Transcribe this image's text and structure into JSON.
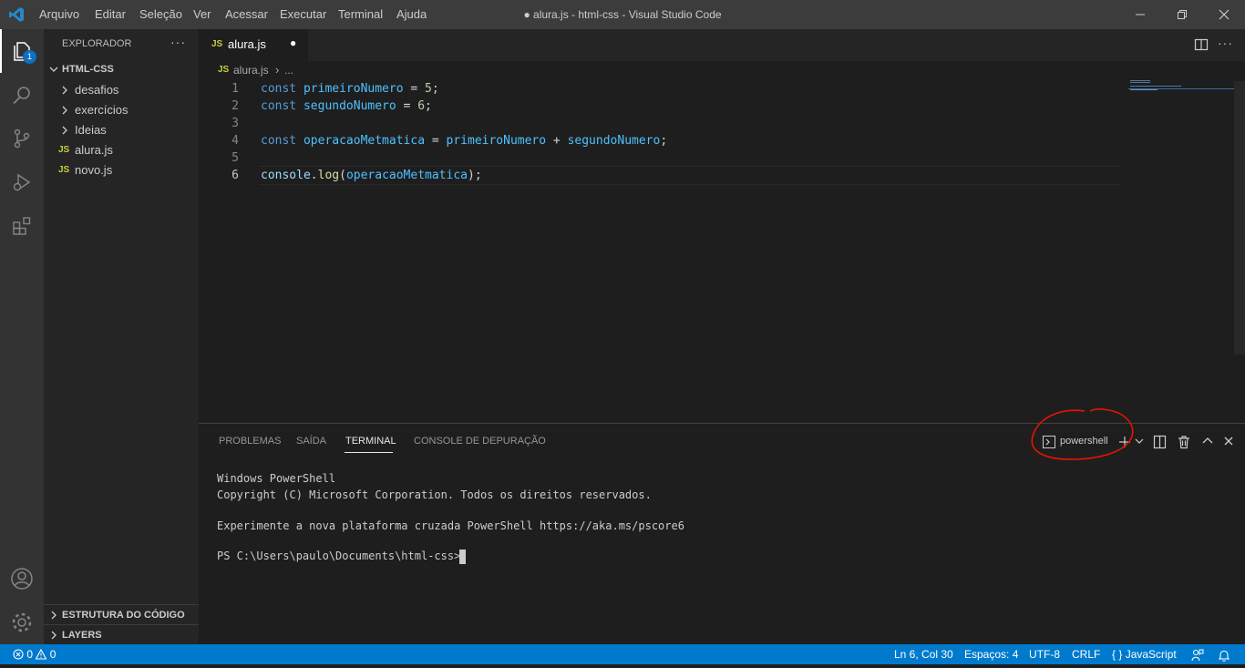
{
  "titlebar": {
    "menu": [
      "Arquivo",
      "Editar",
      "Seleção",
      "Ver",
      "Acessar",
      "Executar",
      "Terminal",
      "Ajuda"
    ],
    "title": "● alura.js - html-css - Visual Studio Code",
    "icons": [
      "vscode-logo-icon",
      "minimize-icon",
      "restore-icon",
      "close-icon"
    ]
  },
  "activitybar": {
    "explorer_badge": "1",
    "icons": [
      "explorer-icon",
      "search-icon",
      "source-control-icon",
      "run-debug-icon",
      "extensions-icon",
      "accounts-icon",
      "manage-gear-icon"
    ]
  },
  "sidebar": {
    "title": "EXPLORADOR",
    "more": "···",
    "folder": "HTML-CSS",
    "items": [
      {
        "label": "desafios",
        "type": "folder"
      },
      {
        "label": "exercícios",
        "type": "folder"
      },
      {
        "label": "Ideias",
        "type": "folder"
      },
      {
        "label": "alura.js",
        "type": "file",
        "badge": "JS"
      },
      {
        "label": "novo.js",
        "type": "file",
        "badge": "JS"
      }
    ],
    "bottom_sections": [
      "ESTRUTURA DO CÓDIGO",
      "LAYERS"
    ]
  },
  "editor": {
    "tab": {
      "badge": "JS",
      "label": "alura.js",
      "dirty": "●"
    },
    "breadcrumb": {
      "badge": "JS",
      "file": "alura.js",
      "sep": "›",
      "more": "..."
    },
    "line_numbers": [
      "1",
      "2",
      "3",
      "4",
      "5",
      "6"
    ],
    "code": {
      "l1": {
        "kw": "const",
        "var": "primeiroNumero",
        "op": "=",
        "num": "5",
        "end": ";"
      },
      "l2": {
        "kw": "const",
        "var": "segundoNumero",
        "op": "=",
        "num": "6",
        "end": ";"
      },
      "l4": {
        "kw": "const",
        "var": "operacaoMetmatica",
        "op": "=",
        "a": "primeiroNumero",
        "plus": "+",
        "b": "segundoNumero",
        "end": ";"
      },
      "l6": {
        "obj": "console",
        "dot": ".",
        "fn": "log",
        "open": "(",
        "arg": "operacaoMetmatica",
        "close": ");"
      }
    }
  },
  "panel": {
    "tabs": [
      "PROBLEMAS",
      "SAÍDA",
      "TERMINAL",
      "CONSOLE DE DEPURAÇÃO"
    ],
    "active_tab": "TERMINAL",
    "shell": "powershell",
    "terminal_lines": [
      "Windows PowerShell",
      "Copyright (C) Microsoft Corporation. Todos os direitos reservados.",
      "Experimente a nova plataforma cruzada PowerShell https://aka.ms/pscore6",
      "PS C:\\Users\\paulo\\Documents\\html-css> "
    ]
  },
  "statusbar": {
    "errors": "0",
    "warnings": "0",
    "position": "Ln 6, Col 30",
    "spaces": "Espaços: 4",
    "encoding": "UTF-8",
    "eol": "CRLF",
    "language": "JavaScript",
    "language_icon": "{ }"
  },
  "colors": {
    "titlebar": "#3c3c3c",
    "activitybar": "#333333",
    "sidebar": "#252526",
    "editor": "#1e1e1e",
    "statusbar": "#007acc",
    "annotation": "#e51400"
  }
}
